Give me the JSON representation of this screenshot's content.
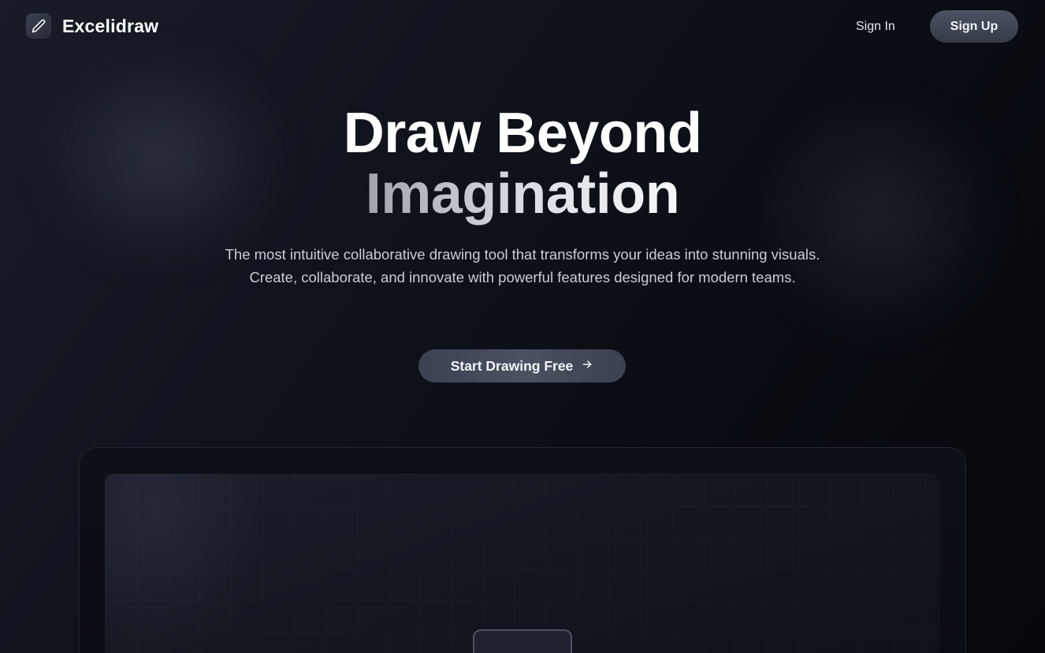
{
  "header": {
    "brand": "Excelidraw",
    "brand_icon": "pencil-icon",
    "sign_in_label": "Sign In",
    "sign_up_label": "Sign Up"
  },
  "hero": {
    "title_line1": "Draw Beyond",
    "title_line2": "Imagination",
    "subtitle": "The most intuitive collaborative drawing tool that transforms your ideas into stunning visuals. Create, collaborate, and innovate with powerful features designed for modern teams.",
    "cta_label": "Start Drawing Free",
    "cta_icon": "arrow-right-icon"
  },
  "colors": {
    "background": "#0b0e15",
    "button": "#3f4654",
    "text": "#ffffff",
    "muted_text": "#c9ced6"
  }
}
